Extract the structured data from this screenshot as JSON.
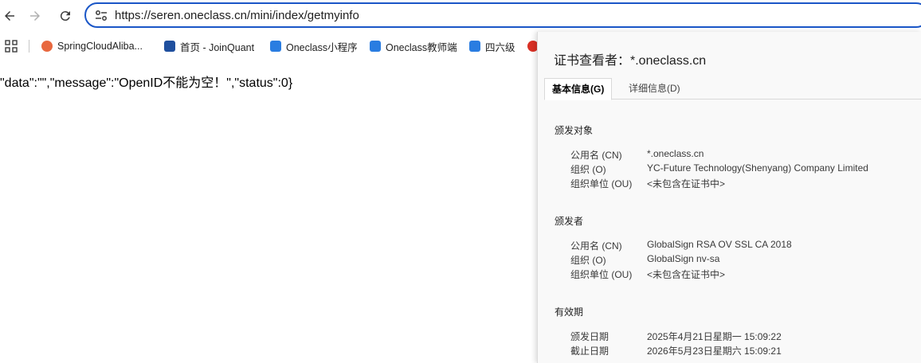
{
  "browser": {
    "url": "https://seren.oneclass.cn/mini/index/getmyinfo"
  },
  "bookmarks": [
    {
      "label": "SpringCloudAliba...",
      "color": "#e8683f"
    },
    {
      "label": "首页 - JoinQuant",
      "color": "#1f4f9e"
    },
    {
      "label": "Oneclass小程序",
      "color": "#2a7de1"
    },
    {
      "label": "Oneclass教师端",
      "color": "#2a7de1"
    },
    {
      "label": "四六级",
      "color": "#2a7de1"
    }
  ],
  "page": {
    "body_text": "\"data\":\"\",\"message\":\"OpenID不能为空！\",\"status\":0}"
  },
  "certificate": {
    "title": "证书查看者：*.oneclass.cn",
    "tabs": [
      "基本信息(G)",
      "详细信息(D)"
    ],
    "issued_to": {
      "heading": "颁发对象",
      "rows": [
        {
          "label": "公用名 (CN)",
          "value": "*.oneclass.cn"
        },
        {
          "label": "组织 (O)",
          "value": "YC-Future Technology(Shenyang) Company Limited"
        },
        {
          "label": "组织单位 (OU)",
          "value": "<未包含在证书中>"
        }
      ]
    },
    "issued_by": {
      "heading": "颁发者",
      "rows": [
        {
          "label": "公用名 (CN)",
          "value": "GlobalSign RSA OV SSL CA 2018"
        },
        {
          "label": "组织 (O)",
          "value": "GlobalSign nv-sa"
        },
        {
          "label": "组织单位 (OU)",
          "value": "<未包含在证书中>"
        }
      ]
    },
    "validity": {
      "heading": "有效期",
      "rows": [
        {
          "label": "颁发日期",
          "value": "2025年4月21日星期一 15:09:22"
        },
        {
          "label": "截止日期",
          "value": "2026年5月23日星期六 15:09:21"
        }
      ]
    }
  }
}
